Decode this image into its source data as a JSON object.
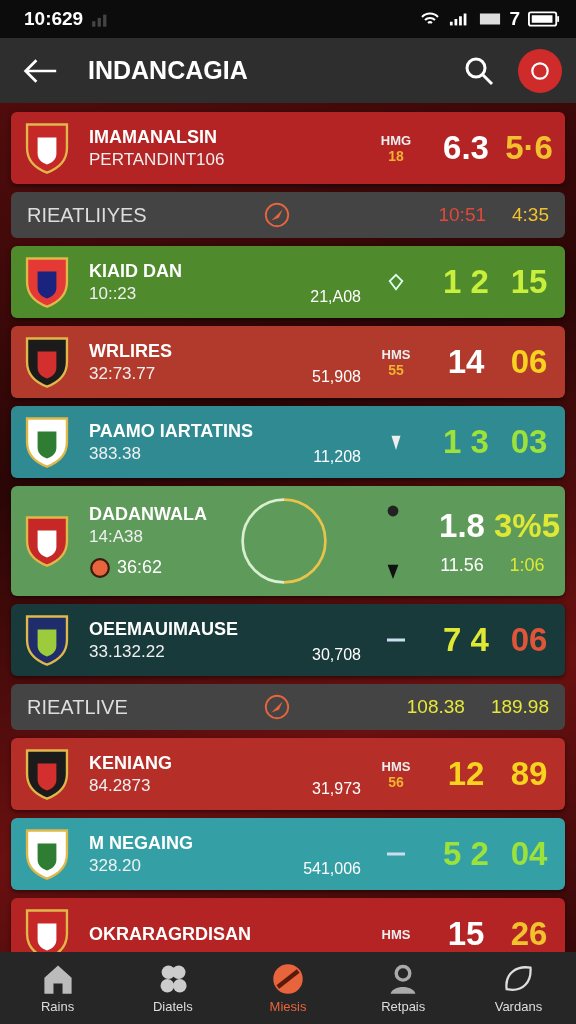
{
  "status_bar": {
    "time": "10:629",
    "battery": "7"
  },
  "header": {
    "title": "INDANCAGIA"
  },
  "rows": [
    {
      "kind": "match",
      "color": "#b52424",
      "name": "IMAMANALSIN",
      "sub": "PERTANDINT106",
      "tag": [
        "HMG",
        "18"
      ],
      "scores": [
        {
          "text": "6.3",
          "color": "#ffffff"
        },
        {
          "text": "5·6",
          "color": "#f2c12e"
        }
      ]
    },
    {
      "kind": "section",
      "label": "RIEATLIIYES",
      "times": [
        {
          "text": "10:51",
          "color": "#e0493a"
        },
        {
          "text": "4:35",
          "color": "#f2c12e"
        }
      ]
    },
    {
      "kind": "match",
      "color": "#4f8a2c",
      "name": "KIAID DAN",
      "sub": "10::23",
      "stat": "21,A08",
      "scores": [
        {
          "text": "1 2",
          "color": "#c8ef3c"
        },
        {
          "text": "15",
          "color": "#c8ef3c"
        }
      ]
    },
    {
      "kind": "match",
      "color": "#b23a2c",
      "name": "WRLIRES",
      "sub": "32:73.77",
      "stat": "51,908",
      "tag": [
        "HMS",
        "55"
      ],
      "scores": [
        {
          "text": "14",
          "color": "#ffffff"
        },
        {
          "text": "06",
          "color": "#f7d21e"
        }
      ]
    },
    {
      "kind": "match",
      "color": "#2f8a92",
      "name": "PAAMO IARTATINS",
      "sub": "383.38",
      "stat": "11,208",
      "scores": [
        {
          "text": "1 3",
          "color": "#9ce23a"
        },
        {
          "text": "03",
          "color": "#9ce23a"
        }
      ]
    },
    {
      "kind": "feature",
      "color": "#5e9a5a",
      "name": "DADANWALA",
      "sub": "14:A38",
      "note": "36:62",
      "scores": [
        {
          "text": "1.8",
          "color": "#ffffff"
        },
        {
          "text": "3%5",
          "color": "#dfe834"
        }
      ],
      "extra": [
        {
          "text": "11.56",
          "color": "#ffffff"
        },
        {
          "text": "1:06",
          "color": "#dfe834"
        }
      ]
    },
    {
      "kind": "match",
      "color": "#183a3a",
      "name": "OEEMAUIMAUSE",
      "sub": "33.132.22",
      "stat": "30,708",
      "scores": [
        {
          "text": "7 4",
          "color": "#dfe834"
        },
        {
          "text": "06",
          "color": "#e0553a"
        }
      ]
    },
    {
      "kind": "section",
      "label": "RIEATLIVE",
      "times": [
        {
          "text": "108.38",
          "color": "#e6e83a"
        },
        {
          "text": "189.98",
          "color": "#e6e83a"
        }
      ]
    },
    {
      "kind": "match",
      "color": "#b52f28",
      "name": "KENIANG",
      "sub": "84.2873",
      "stat": "31,973",
      "tag": [
        "HMS",
        "56"
      ],
      "scores": [
        {
          "text": "12",
          "color": "#f7d21e"
        },
        {
          "text": "89",
          "color": "#f7d21e"
        }
      ]
    },
    {
      "kind": "match",
      "color": "#34a0a6",
      "name": "M NEGAING",
      "sub": "328.20",
      "stat": "541,006",
      "scores": [
        {
          "text": "5 2",
          "color": "#9ce23a"
        },
        {
          "text": "04",
          "color": "#9ce23a"
        }
      ]
    },
    {
      "kind": "match",
      "color": "#b52424",
      "name": "OKRARAGRDISAN",
      "tag": [
        "HMS"
      ],
      "scores": [
        {
          "text": "15",
          "color": "#ffffff"
        },
        {
          "text": "26",
          "color": "#f2c12e"
        }
      ]
    }
  ],
  "nav": [
    {
      "label": "Rains",
      "selected": false
    },
    {
      "label": "Diatels",
      "selected": false
    },
    {
      "label": "Miesis",
      "selected": true
    },
    {
      "label": "Retpais",
      "selected": false
    },
    {
      "label": "Vardans",
      "selected": false
    }
  ]
}
